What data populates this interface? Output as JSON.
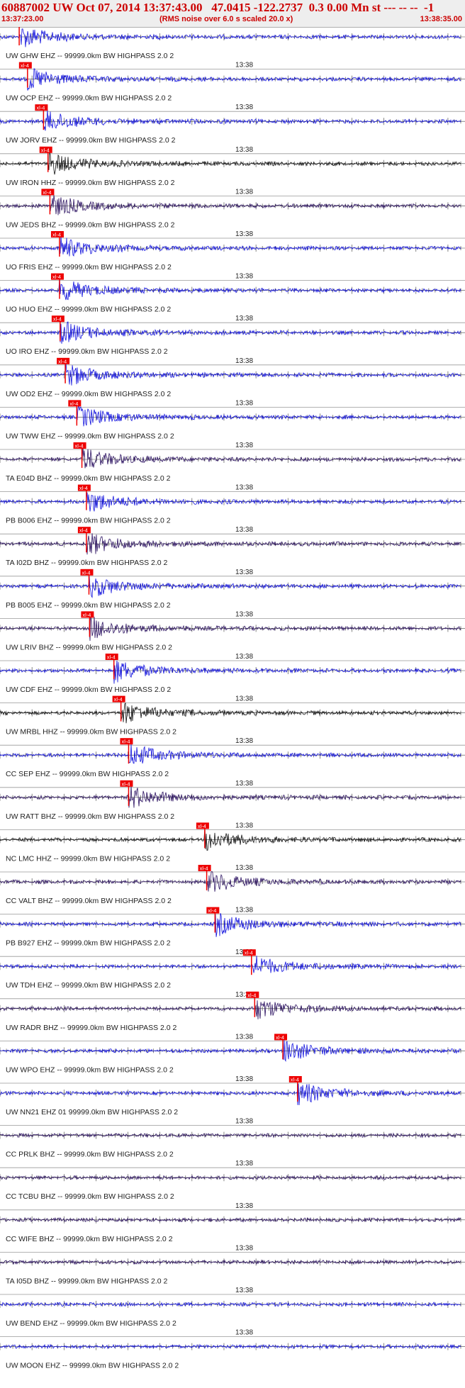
{
  "header": {
    "title": "60887002 UW Oct 07, 2014 13:37:43.00   47.0415 -122.2737  0.3 0.00 Mn st --- -- --  -1",
    "time_start": "13:37:23.00",
    "note": "(RMS noise over 6.0 s scaled 20.0 x)",
    "time_end": "13:38:35.00"
  },
  "minute_label": "13:38",
  "pick_label": "xl-4",
  "colors": {
    "trace_blue": "#1010dd",
    "trace_black": "#111111",
    "trace_purple": "#2a1060",
    "pick": "#ee0000",
    "title": "#cc0000"
  },
  "chart_data": {
    "type": "seismogram",
    "x_unit": "time (UTC)",
    "x_range": [
      "13:37:23.00",
      "13:38:35.00"
    ],
    "traces": [
      {
        "label": "UW GHW EHZ -- 99999.0km BW  HIGHPASS  2.0  2",
        "color": "blue",
        "pick": "13:37:26.0"
      },
      {
        "label": "UW OCP EHZ -- 99999.0km BW  HIGHPASS  2.0  2",
        "color": "blue",
        "pick": "13:37:27.3"
      },
      {
        "label": "UW JORV EHZ -- 99999.0km BW  HIGHPASS  2.0  2",
        "color": "blue",
        "pick": "13:37:29.8"
      },
      {
        "label": "UW IRON HHZ -- 99999.0km BW  HIGHPASS  2.0  2",
        "color": "black",
        "pick": "13:37:30.5"
      },
      {
        "label": "UW JEDS BHZ -- 99999.0km BW  HIGHPASS  2.0  2",
        "color": "purple",
        "pick": "13:37:30.8"
      },
      {
        "label": "UO FRIS EHZ -- 99999.0km BW  HIGHPASS  2.0  2",
        "color": "blue",
        "pick": "13:37:32.3"
      },
      {
        "label": "UO HUO EHZ -- 99999.0km BW  HIGHPASS  2.0  2",
        "color": "blue",
        "pick": "13:37:32.3"
      },
      {
        "label": "UO IRO EHZ -- 99999.0km BW  HIGHPASS  2.0  2",
        "color": "blue",
        "pick": "13:37:32.4"
      },
      {
        "label": "UW OD2 EHZ -- 99999.0km BW  HIGHPASS  2.0  2",
        "color": "blue",
        "pick": "13:37:33.2"
      },
      {
        "label": "UW TWW EHZ -- 99999.0km BW  HIGHPASS  2.0  2",
        "color": "blue",
        "pick": "13:37:35.0"
      },
      {
        "label": "TA E04D BHZ -- 99999.0km BW  HIGHPASS  2.0  2",
        "color": "purple",
        "pick": "13:37:35.8"
      },
      {
        "label": "PB B006 EHZ -- 99999.0km BW  HIGHPASS  2.0  2",
        "color": "blue",
        "pick": "13:37:36.5"
      },
      {
        "label": "TA I02D BHZ -- 99999.0km BW  HIGHPASS  2.0  2",
        "color": "purple",
        "pick": "13:37:36.5"
      },
      {
        "label": "PB B005 EHZ -- 99999.0km BW  HIGHPASS  2.0  2",
        "color": "blue",
        "pick": "13:37:36.9"
      },
      {
        "label": "UW LRIV BHZ -- 99999.0km BW  HIGHPASS  2.0  2",
        "color": "purple",
        "pick": "13:37:37.0"
      },
      {
        "label": "UW CDF EHZ -- 99999.0km BW  HIGHPASS  2.0  2",
        "color": "blue",
        "pick": "13:37:40.8"
      },
      {
        "label": "UW MRBL HHZ -- 99999.0km BW  HIGHPASS  2.0  2",
        "color": "black",
        "pick": "13:37:41.9"
      },
      {
        "label": "CC SEP EHZ -- 99999.0km BW  HIGHPASS  2.0  2",
        "color": "blue",
        "pick": "13:37:43.1"
      },
      {
        "label": "UW RATT BHZ -- 99999.0km BW  HIGHPASS  2.0  2",
        "color": "purple",
        "pick": "13:37:43.1"
      },
      {
        "label": "NC LMC HHZ -- 99999.0km BW  HIGHPASS  2.0  2",
        "color": "black",
        "pick": "13:37:55.0"
      },
      {
        "label": "CC VALT BHZ -- 99999.0km BW  HIGHPASS  2.0  2",
        "color": "purple",
        "pick": "13:37:55.3"
      },
      {
        "label": "PB B927 EHZ -- 99999.0km BW  HIGHPASS  2.0  2",
        "color": "blue",
        "pick": "13:37:56.6"
      },
      {
        "label": "UW TDH EHZ -- 99999.0km BW  HIGHPASS  2.0  2",
        "color": "blue",
        "pick": "13:38:02.3"
      },
      {
        "label": "UW RADR BHZ -- 99999.0km BW  HIGHPASS  2.0  2",
        "color": "purple",
        "pick": "13:38:02.8"
      },
      {
        "label": "UW WPO EHZ -- 99999.0km BW  HIGHPASS  2.0  2",
        "color": "blue",
        "pick": "13:38:07.2"
      },
      {
        "label": "UW NN21 EHZ 01 99999.0km BW  HIGHPASS  2.0  2",
        "color": "blue",
        "pick": "13:38:09.5"
      },
      {
        "label": "CC PRLK BHZ -- 99999.0km BW  HIGHPASS  2.0  2",
        "color": "purple",
        "pick": null
      },
      {
        "label": "CC TCBU BHZ -- 99999.0km BW  HIGHPASS  2.0  2",
        "color": "purple",
        "pick": null
      },
      {
        "label": "CC WIFE BHZ -- 99999.0km BW  HIGHPASS  2.0  2",
        "color": "purple",
        "pick": null
      },
      {
        "label": "TA I05D BHZ -- 99999.0km BW  HIGHPASS  2.0  2",
        "color": "purple",
        "pick": null
      },
      {
        "label": "UW BEND EHZ -- 99999.0km BW  HIGHPASS  2.0  2",
        "color": "blue",
        "pick": null
      },
      {
        "label": "UW MOON EHZ -- 99999.0km BW  HIGHPASS  2.0  2",
        "color": "blue",
        "pick": null
      }
    ]
  }
}
